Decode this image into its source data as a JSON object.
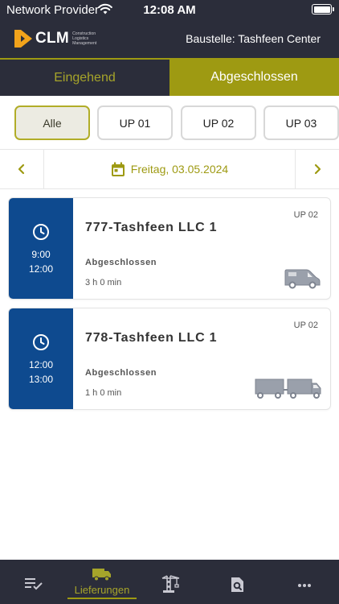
{
  "status_bar": {
    "carrier": "Network Provider",
    "time": "12:08 AM"
  },
  "header": {
    "logo_text": "CLM",
    "logo_sub_1": "Construction",
    "logo_sub_2": "Logistics",
    "logo_sub_3": "Management",
    "site_label": "Baustelle: Tashfeen Center"
  },
  "tabs": [
    {
      "label": "Eingehend",
      "active": false
    },
    {
      "label": "Abgeschlossen",
      "active": true
    }
  ],
  "filters": [
    {
      "label": "Alle",
      "selected": true
    },
    {
      "label": "UP 01",
      "selected": false
    },
    {
      "label": "UP 02",
      "selected": false
    },
    {
      "label": "UP 03",
      "selected": false
    }
  ],
  "date_bar": {
    "date": "Freitag, 03.05.2024",
    "prev_icon": "chevron-left-icon",
    "next_icon": "chevron-right-icon",
    "calendar_icon": "calendar-icon"
  },
  "deliveries": [
    {
      "start": "9:00",
      "end": "12:00",
      "title": "777-Tashfeen LLC 1",
      "unit": "UP 02",
      "status": "Abgeschlossen",
      "duration": "3 h 0 min",
      "vehicle_icon": "van-icon"
    },
    {
      "start": "12:00",
      "end": "13:00",
      "title": "778-Tashfeen LLC 1",
      "unit": "UP 02",
      "status": "Abgeschlossen",
      "duration": "1 h 0 min",
      "vehicle_icon": "truck-trailer-icon"
    }
  ],
  "bottom_nav": [
    {
      "label": "",
      "icon": "checklist-icon",
      "active": false
    },
    {
      "label": "Lieferungen",
      "icon": "delivery-truck-icon",
      "active": true
    },
    {
      "label": "",
      "icon": "crane-icon",
      "active": false
    },
    {
      "label": "",
      "icon": "document-search-icon",
      "active": false
    },
    {
      "label": "",
      "icon": "more-icon",
      "active": false
    }
  ],
  "colors": {
    "dark": "#2b2d3a",
    "accent": "#9e9a12",
    "card_blue": "#0e4a8f"
  }
}
